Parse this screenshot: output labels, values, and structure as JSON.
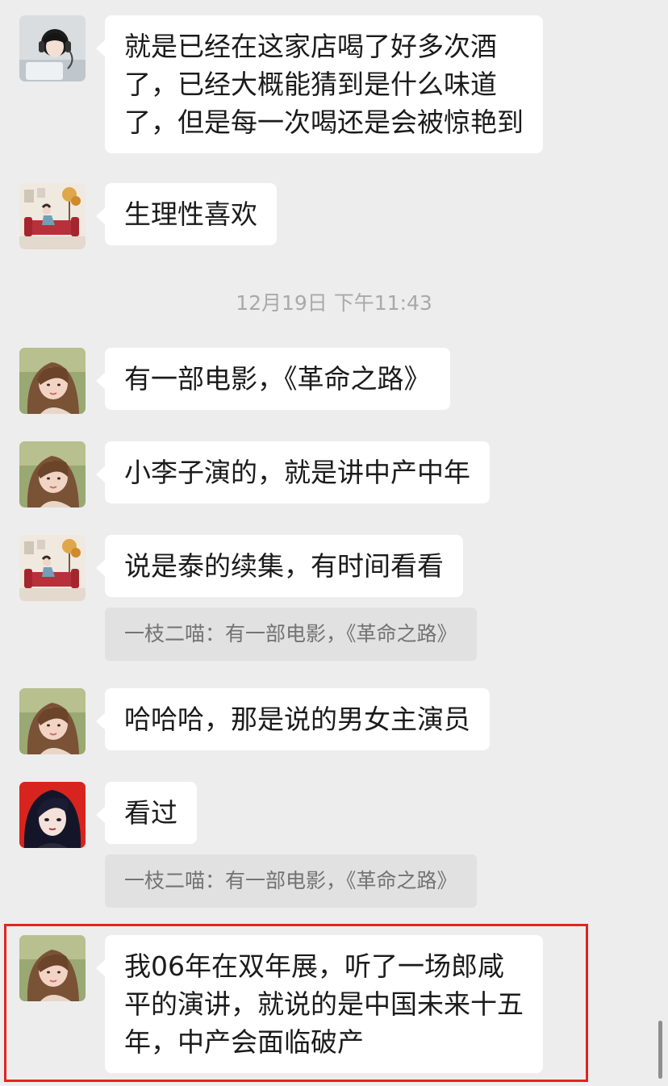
{
  "messages": [
    {
      "avatar": "headphones-girl-avatar",
      "lines": [
        "就是已经在这家店喝了好多次酒",
        "了，已经大概能猜到是什么味道",
        "了，但是每一次喝还是会被惊艳到"
      ]
    },
    {
      "avatar": "sofa-room-avatar",
      "lines": [
        "生理性喜欢"
      ]
    },
    {
      "avatar": "long-hair-girl-avatar",
      "lines": [
        "有一部电影，《革命之路》"
      ]
    },
    {
      "avatar": "long-hair-girl-avatar",
      "lines": [
        "小李子演的，就是讲中产中年"
      ]
    },
    {
      "avatar": "sofa-room-avatar",
      "lines": [
        "说是泰的续集，有时间看看"
      ],
      "quote": "一枝二喵：有一部电影，《革命之路》"
    },
    {
      "avatar": "long-hair-girl-avatar",
      "lines": [
        "哈哈哈，那是说的男女主演员"
      ]
    },
    {
      "avatar": "anime-girl-avatar",
      "lines": [
        "看过"
      ],
      "quote": "一枝二喵：有一部电影，《革命之路》"
    },
    {
      "avatar": "long-hair-girl-avatar",
      "lines": [
        "我06年在双年展，听了一场郎咸",
        "平的演讲，就说的是中国未来十五",
        "年，中产会面临破产"
      ]
    }
  ],
  "timestamp": "12月19日 下午11:43",
  "colors": {
    "background": "#ededed",
    "bubble": "#ffffff",
    "quote_background": "#e1e1e1",
    "highlight_border": "#e3231f"
  }
}
